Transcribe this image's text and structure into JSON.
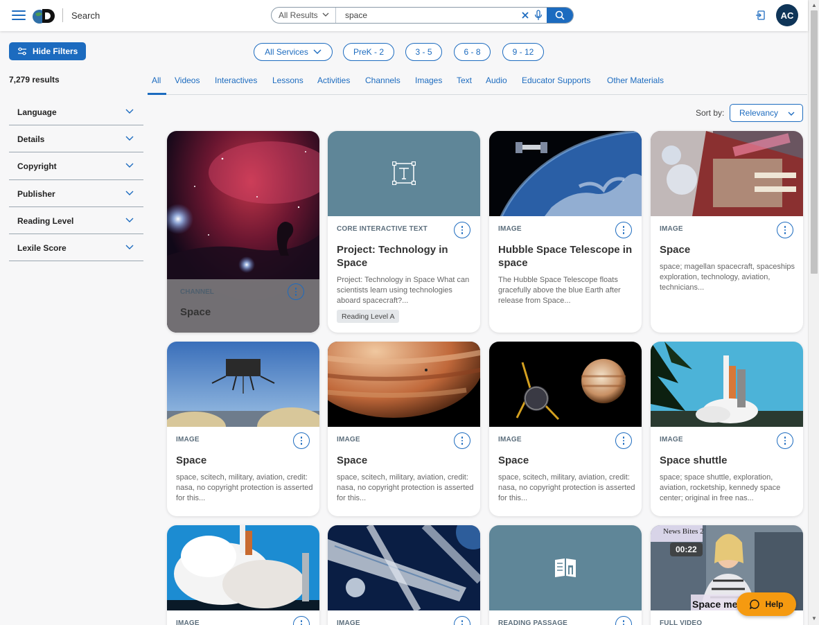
{
  "header": {
    "brand_label": "Search",
    "scope": "All Results",
    "search_value": "space",
    "avatar_initials": "AC"
  },
  "filters": {
    "hide_label": "Hide Filters",
    "results_count": "7,279 results",
    "items": [
      {
        "label": "Language"
      },
      {
        "label": "Details"
      },
      {
        "label": "Copyright"
      },
      {
        "label": "Publisher"
      },
      {
        "label": "Reading Level"
      },
      {
        "label": "Lexile Score"
      }
    ]
  },
  "grades": {
    "services_label": "All Services",
    "pills": [
      "PreK - 2",
      "3 - 5",
      "6 - 8",
      "9 - 12"
    ]
  },
  "tabs": [
    "All",
    "Videos",
    "Interactives",
    "Lessons",
    "Activities",
    "Channels",
    "Images",
    "Text",
    "Audio",
    "Educator Supports",
    "Other Materials"
  ],
  "active_tab": "All",
  "sort": {
    "label": "Sort by:",
    "value": "Relevancy"
  },
  "cards": [
    {
      "type": "CHANNEL",
      "title": "Space",
      "desc": ""
    },
    {
      "type": "CORE INTERACTIVE TEXT",
      "title": "Project: Technology in Space",
      "desc": "Project: Technology in Space What can scientists learn using technologies aboard spacecraft?...",
      "badge": "Reading Level A"
    },
    {
      "type": "IMAGE",
      "title": "Hubble Space Telescope in space",
      "desc": "The Hubble Space Telescope floats gracefully above the blue Earth after release from Space..."
    },
    {
      "type": "IMAGE",
      "title": "Space",
      "desc": "space; magellan spacecraft, spaceships exploration, technology, aviation, technicians..."
    },
    {
      "type": "IMAGE",
      "title": "Space",
      "desc": "space, scitech, military, aviation, credit: nasa, no copyright protection is asserted for this..."
    },
    {
      "type": "IMAGE",
      "title": "Space",
      "desc": "space, scitech, military, aviation, credit: nasa, no copyright protection is asserted for this..."
    },
    {
      "type": "IMAGE",
      "title": "Space",
      "desc": "space, scitech, military, aviation, credit: nasa, no copyright protection is asserted for this..."
    },
    {
      "type": "IMAGE",
      "title": "Space shuttle",
      "desc": "space; space shuttle, exploration, aviation, rocketship, kennedy space center; original in free nas..."
    },
    {
      "type": "IMAGE",
      "title": "",
      "desc": ""
    },
    {
      "type": "IMAGE",
      "title": "",
      "desc": ""
    },
    {
      "type": "READING PASSAGE",
      "title": "",
      "desc": ""
    },
    {
      "type": "FULL VIDEO",
      "title": "",
      "desc": "",
      "duration": "00:22",
      "thumb_caption_top": "News Bites 2",
      "thumb_caption_bottom": "Space me"
    }
  ],
  "help_label": "Help",
  "colors": {
    "accent": "#1c6bbf",
    "navy": "#0f3558",
    "help": "#f59a10",
    "slate_thumb": "#5f8698"
  }
}
